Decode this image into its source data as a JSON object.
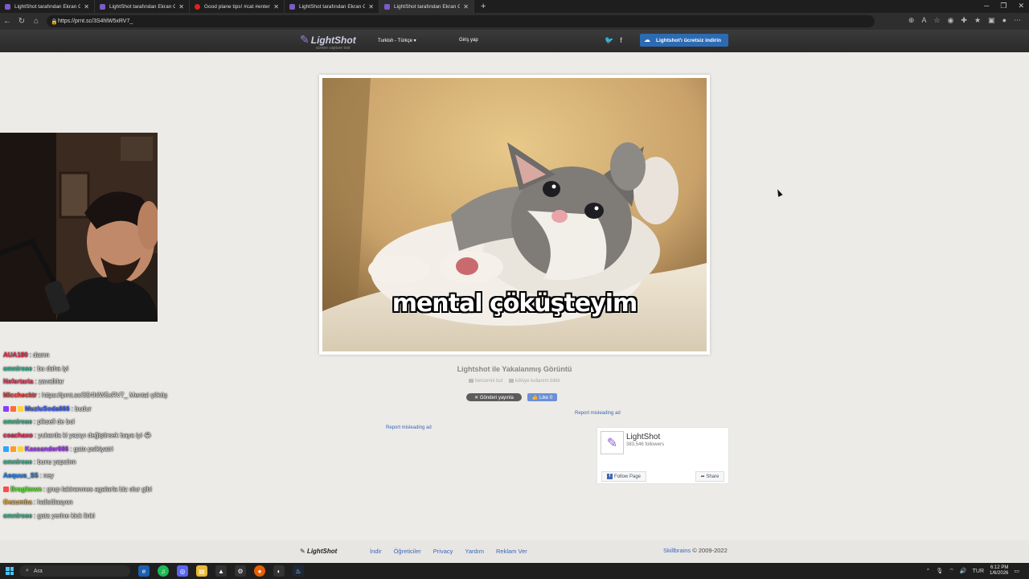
{
  "browser": {
    "tabs": [
      {
        "title": "LightShot tarafından Ekran Görüntüsü",
        "icon": "lightshot-icon"
      },
      {
        "title": "LightShot tarafından Ekran Görüntüsü",
        "icon": "lightshot-icon"
      },
      {
        "title": "Good plane tips! #cat #entertainment",
        "icon": "youtube-icon"
      },
      {
        "title": "LightShot tarafından Ekran Görüntüsü",
        "icon": "lightshot-icon"
      },
      {
        "title": "LightShot tarafından Ekran Görüntüsü",
        "icon": "lightshot-icon",
        "active": true
      }
    ],
    "url": "https://prnt.sc/3S4hlW5xRV7_"
  },
  "header": {
    "logo": "LightShot",
    "tagline": "screen capture tool",
    "language": "Turkish - Türkçe ▾",
    "login": "Giriş yap",
    "download_button": "Lightshot'ı ücretsiz indirin"
  },
  "screenshot": {
    "caption": "mental çöküşteyim",
    "title": "Lightshot ile Yakalanmış Görüntü",
    "link_similar": "benzerini bul",
    "link_abuse": "kötüye kullanım bildir",
    "share_label": "✕ Gönderi yayınla",
    "like_label": "👍 Like 0",
    "report_ad_1": "Report misleading ad",
    "report_ad_2": "Report misleading ad"
  },
  "fb": {
    "name": "LightShot",
    "followers": "383,546 followers",
    "follow": "Follow Page",
    "share": "Share"
  },
  "footer": {
    "logo": "LightShot",
    "links": [
      "İndir",
      "Öğreticiler",
      "Privacy",
      "Yardım",
      "Reklam Ver"
    ],
    "company": "Skillbrains",
    "copyright": " © 2009-2022"
  },
  "chat": [
    {
      "user": "AUA180",
      "color": "#ff3355",
      "msg": ": damn",
      "badges": []
    },
    {
      "user": "omnirose",
      "color": "#2fd0a0",
      "msg": ": bu daha iyi",
      "badges": []
    },
    {
      "user": "Nefertaria",
      "color": "#e84a6a",
      "msg": ": zavallılar",
      "badges": []
    },
    {
      "user": "Micchecktr",
      "color": "#ff4040",
      "msg": ": https://prnt.sc/3S4hlW5xRV7_ Mental çöküş",
      "badges": []
    },
    {
      "user": "MuzluSoda666",
      "color": "#4a6cff",
      "msg": ": budur",
      "badges": [
        "#8a3cff",
        "#ff6a3c",
        "#ffd43c"
      ]
    },
    {
      "user": "omnirose",
      "color": "#2fd0a0",
      "msg": ": piksell de bol",
      "badges": []
    },
    {
      "user": "coachaxo",
      "color": "#ff2a5a",
      "msg": ": yukarda ki yazıyı değiştirsek baya iyi 😂",
      "badges": []
    },
    {
      "user": "Kassander666",
      "color": "#b04aff",
      "msg": ": gato psikiyatri",
      "badges": [
        "#2aa7ff",
        "#ff9a2a",
        "#ffd43c"
      ]
    },
    {
      "user": "omnirose",
      "color": "#2fd0a0",
      "msg": ": bunu yapalım",
      "badges": []
    },
    {
      "user": "Aequus_S5",
      "color": "#2a8cff",
      "msg": ": ney",
      "badges": []
    },
    {
      "user": "Bragitown",
      "color": "#6aff3a",
      "msg": ": grup lakiranınes agalarla biz olur gibi",
      "badges": [
        "#ff4a4a"
      ]
    },
    {
      "user": "Gezumba",
      "color": "#ffb02a",
      "msg": ": halisülasyon",
      "badges": []
    },
    {
      "user": "omnirose",
      "color": "#2fd0a0",
      "msg": ": gata yerine kick linki",
      "badges": []
    }
  ],
  "taskbar": {
    "search_placeholder": "Ara",
    "lang": "TUR",
    "time": "6:12 PM",
    "date": "1/6/2026"
  }
}
